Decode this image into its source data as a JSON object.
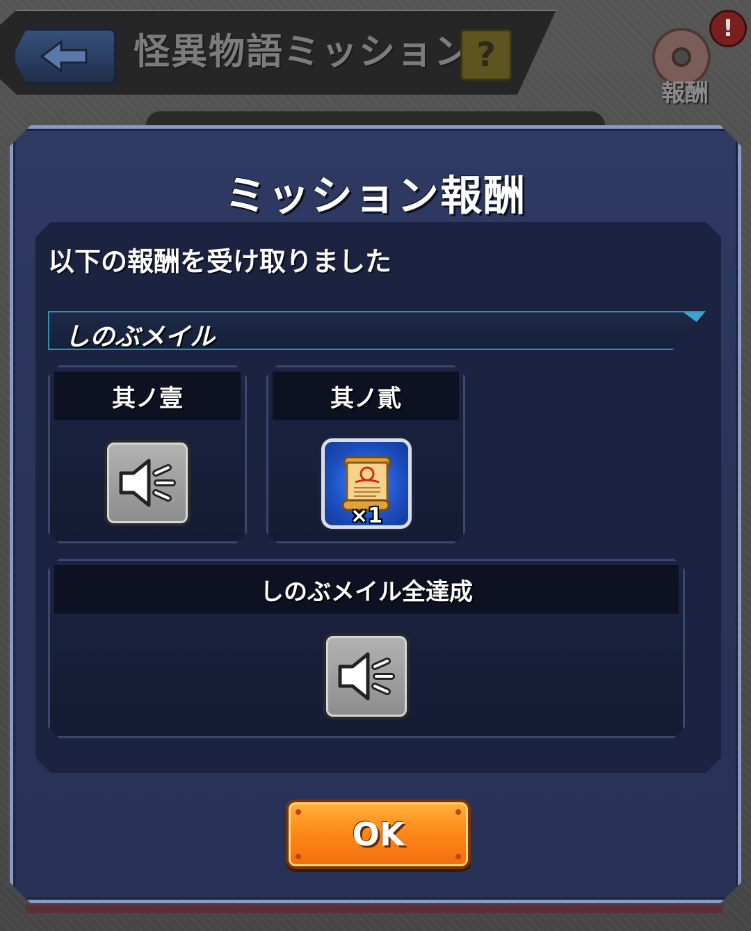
{
  "background": {
    "screen_title": "怪異物語ミッション",
    "help_label": "?",
    "reward_label": "報酬",
    "alert_label": "!",
    "back_icon": "back-arrow-icon",
    "reward_icon": "donut-icon"
  },
  "modal": {
    "title": "ミッション報酬",
    "message": "以下の報酬を受け取りました",
    "section": {
      "label": "しのぶメイル"
    },
    "cards": [
      {
        "label": "其ノ壹",
        "reward_icon": "sound-icon"
      },
      {
        "label": "其ノ貳",
        "reward_icon": "scroll-icon",
        "quantity": "×1"
      },
      {
        "label": "しのぶメイル全達成",
        "reward_icon": "sound-icon"
      }
    ],
    "ok_label": "OK"
  },
  "colors": {
    "accent_orange": "#ff8a1a",
    "panel_navy": "#2a3459",
    "section_border": "#2c8fb6"
  }
}
